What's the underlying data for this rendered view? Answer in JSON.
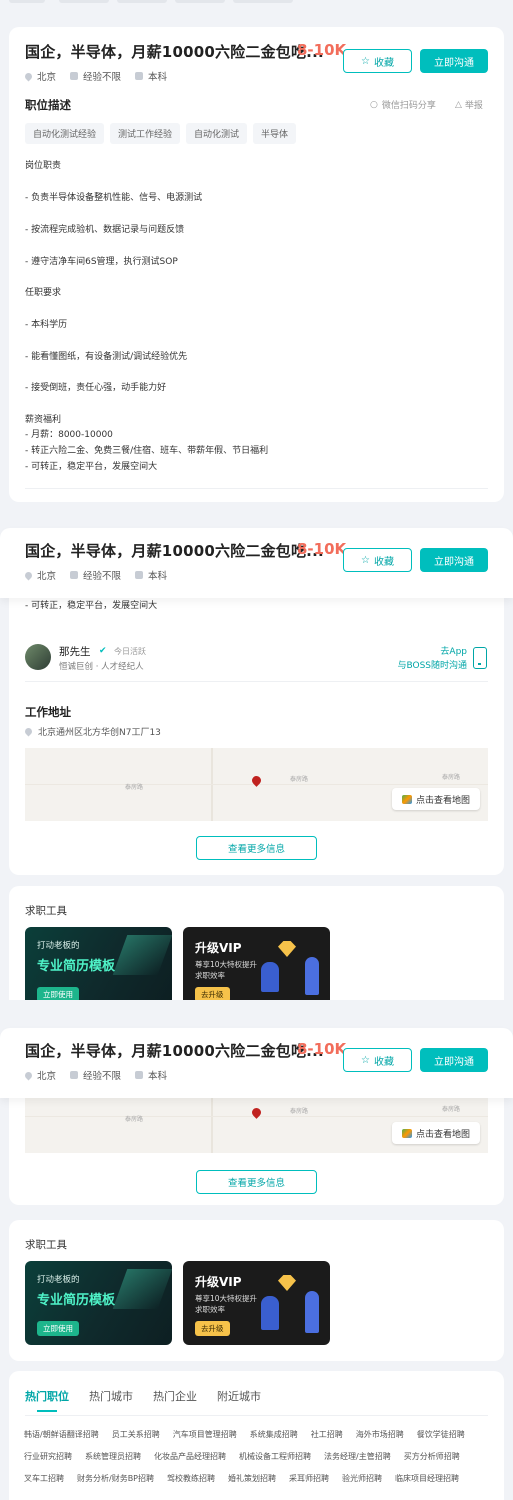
{
  "job": {
    "title": "国企，半导体，月薪10000六险二金包吃...",
    "salary": "8-10K",
    "fav_label": "收藏",
    "chat_label": "立即沟通",
    "city": "北京",
    "experience": "经验不限",
    "education": "本科"
  },
  "description": {
    "title": "职位描述",
    "share_label": "微信扫码分享",
    "report_label": "举报",
    "tags": [
      "自动化测试经验",
      "测试工作经验",
      "自动化测试",
      "半导体"
    ],
    "lines": [
      "岗位职责",
      "- 负责半导体设备整机性能、信号、电源测试",
      "- 按流程完成验机、数据记录与问题反馈",
      "- 遵守洁净车间6S管理，执行测试SOP",
      "任职要求",
      "- 本科学历",
      "- 能看懂图纸，有设备测试/调试经验优先",
      "- 接受倒班，责任心强，动手能力好",
      "薪资福利",
      " - 月薪：8000-10000",
      "- 转正六险二金、免费三餐/住宿、班车、带薪年假、节日福利",
      "- 可转正，稳定平台，发展空间大"
    ]
  },
  "recruiter": {
    "name": "那先生",
    "active": "今日活跃",
    "company_role": "恒诚巨创 · 人才经纪人",
    "app_line1": "去App",
    "app_line2": "与BOSS随时沟通"
  },
  "address": {
    "title": "工作地址",
    "text": "北京通州区北方华创N7工厂13",
    "map_button": "点击查看地图",
    "road_labels": [
      "泰房路",
      "泰房路",
      "泰房路"
    ],
    "more_info": "查看更多信息"
  },
  "tools": {
    "title": "求职工具",
    "resume_small": "打动老板的",
    "resume_big": "专业简历模板",
    "resume_btn": "立即使用",
    "vip_title": "升级VIP",
    "vip_line1": "尊享10大特权提升",
    "vip_line2": "求职效率",
    "vip_btn": "去升级"
  },
  "hot": {
    "tabs": [
      "热门职位",
      "热门城市",
      "热门企业",
      "附近城市"
    ],
    "rows": [
      [
        "韩语/朝鲜语翻译招聘",
        "员工关系招聘",
        "汽车项目管理招聘",
        "系统集成招聘",
        "社工招聘",
        "海外市场招聘",
        "餐饮学徒招聘"
      ],
      [
        "行业研究招聘",
        "系统管理员招聘",
        "化妆品产品经理招聘",
        "机械设备工程师招聘",
        "法务经理/主管招聘",
        "买方分析师招聘"
      ],
      [
        "叉车工招聘",
        "财务分析/财务BP招聘",
        "驾校教练招聘",
        "婚礼策划招聘",
        "采耳师招聘",
        "验光师招聘",
        "临床项目经理招聘"
      ]
    ]
  },
  "colors": {
    "accent": "#00bebd",
    "salary": "#f26d5b"
  }
}
